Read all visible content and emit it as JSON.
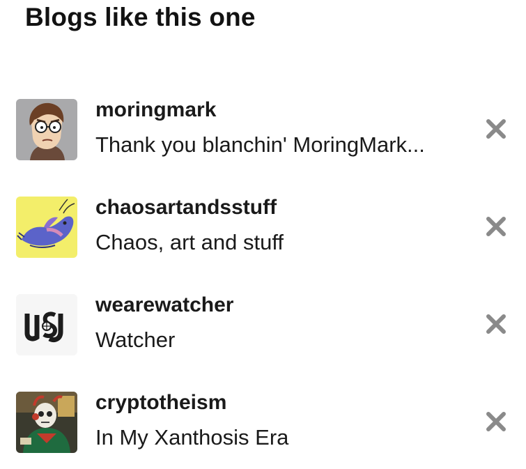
{
  "section": {
    "title": "Blogs like this one"
  },
  "blogs": [
    {
      "name": "moringmark",
      "description": "Thank you blanchin' MoringMark...",
      "avatar_icon": "cartoon-man-with-glasses-avatar",
      "dismiss_icon": "close-icon"
    },
    {
      "name": "chaosartandsstuff",
      "description": "Chaos, art and stuff",
      "avatar_icon": "blue-dragon-on-yellow-avatar",
      "dismiss_icon": "close-icon"
    },
    {
      "name": "wearewatcher",
      "description": "Watcher",
      "avatar_icon": "watcher-logo-avatar",
      "dismiss_icon": "close-icon"
    },
    {
      "name": "cryptotheism",
      "description": "In My Xanthosis Era",
      "avatar_icon": "skull-figure-in-green-coat-avatar",
      "dismiss_icon": "close-icon"
    }
  ],
  "colors": {
    "text": "#1a1a1a",
    "dismiss": "#8a8a8a",
    "background": "#ffffff"
  }
}
